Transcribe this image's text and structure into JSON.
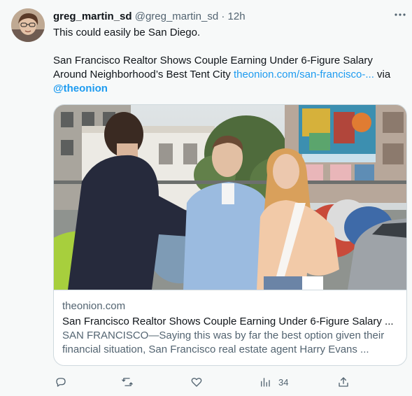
{
  "tweet": {
    "display_name": "greg_martin_sd",
    "handle": "@greg_martin_sd",
    "separator": "·",
    "time": "12h",
    "line1": "This could easily be San Diego.",
    "line2_text": "San Francisco Realtor Shows Couple Earning Under 6-Figure Salary Around Neighborhood’s Best Tent City ",
    "link_text": "theonion.com/san-francisco-...",
    "via_text": " via",
    "mention": "@theonion"
  },
  "card": {
    "domain": "theonion.com",
    "title": "San Francisco Realtor Shows Couple Earning Under 6-Figure Salary ...",
    "description": "SAN FRANCISCO—Saying this was by far the best option given their financial situation, San Francisco real estate agent Harry Evans ..."
  },
  "actions": {
    "reply_icon": "reply-icon",
    "retweet_icon": "retweet-icon",
    "like_icon": "heart-icon",
    "views_icon": "views-icon",
    "views_count": "34",
    "share_icon": "share-icon"
  },
  "colors": {
    "link": "#1d9bf0",
    "secondary_text": "#536471",
    "background": "#f7f9f9",
    "border": "#cfd9de"
  }
}
